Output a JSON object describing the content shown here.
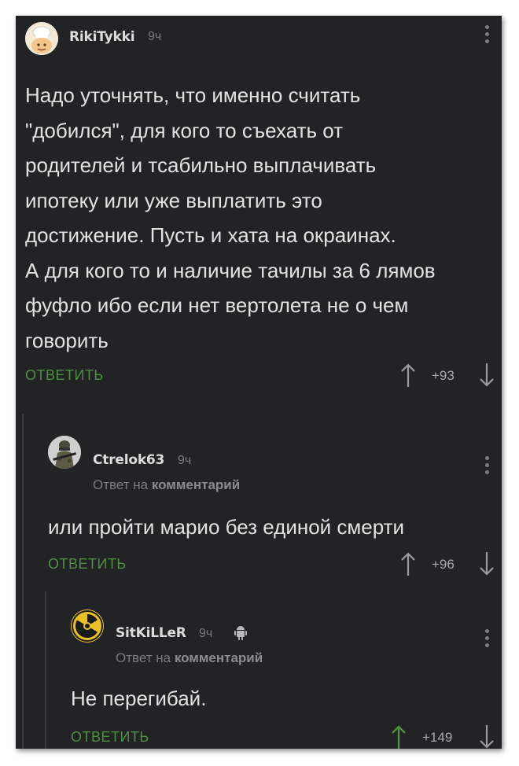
{
  "colors": {
    "background": "#222325",
    "text": "#e2e2e2",
    "meta": "#7b7c7e",
    "reply_link": "#4f8f41",
    "upvote_active": "#4f8f41",
    "vote_idle": "#9a9b9d"
  },
  "comments": [
    {
      "username": "RikiTykki",
      "time": "9ч",
      "avatar_icon": "chef-avatar-icon",
      "lines": [
        "Надо уточнять, что именно считать",
        "\"добился\", для кого то съехать от",
        "родителей и тсабильно выплачивать",
        "ипотеку или уже выплатить это",
        "достижение. Пусть и хата на окраинах.",
        "А для кого то и наличие тачилы за 6 лямов",
        "фуфло ибо если нет вертолета не о чем",
        "говорить"
      ],
      "reply_label": "ОТВЕТИТЬ",
      "score": "+93",
      "upvoted": false
    },
    {
      "username": "Ctrelok63",
      "time": "9ч",
      "avatar_icon": "soldier-avatar-icon",
      "reply_prefix": "Ответ на ",
      "reply_target": "комментарий",
      "lines": [
        "или пройти марио без единой смерти"
      ],
      "reply_label": "ОТВЕТИТЬ",
      "score": "+96",
      "upvoted": false
    },
    {
      "username": "SitKiLLeR",
      "time": "9ч",
      "avatar_icon": "radiation-avatar-icon",
      "platform_icon": "android-icon",
      "reply_prefix": "Ответ на ",
      "reply_target": "комментарий",
      "lines": [
        "Не перегибай."
      ],
      "reply_label": "ОТВЕТИТЬ",
      "score": "+149",
      "upvoted": true
    }
  ]
}
